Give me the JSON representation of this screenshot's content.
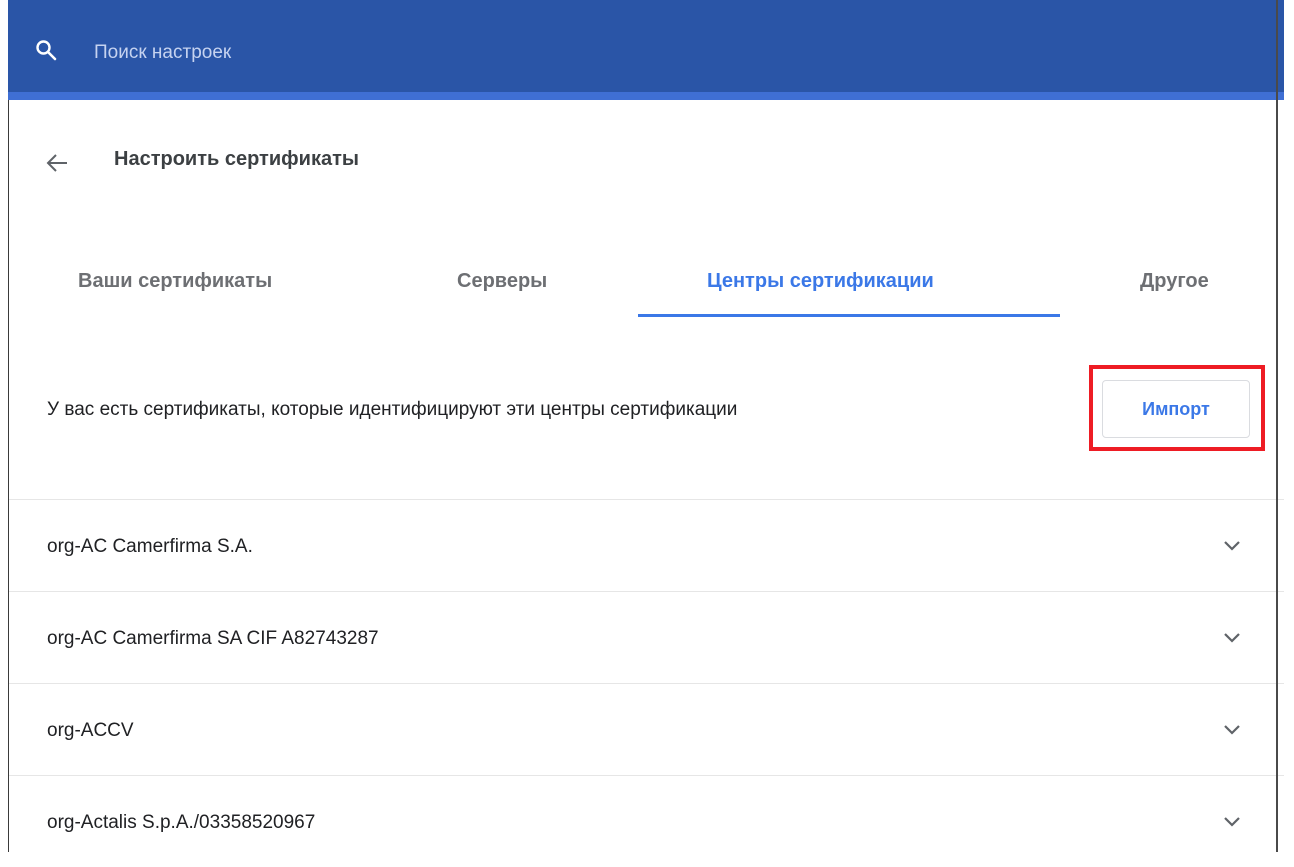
{
  "search": {
    "placeholder": "Поиск настроек"
  },
  "header": {
    "title": "Настроить сертификаты"
  },
  "tabs": [
    {
      "label": "Ваши сертификаты"
    },
    {
      "label": "Серверы"
    },
    {
      "label": "Центры сертификации",
      "active": true
    },
    {
      "label": "Другое"
    }
  ],
  "main": {
    "description": "У вас есть сертификаты, которые идентифицируют эти центры сертификации",
    "import_label": "Импорт"
  },
  "certificates": [
    {
      "name": "org-AC Camerfirma S.A."
    },
    {
      "name": "org-AC Camerfirma SA CIF A82743287"
    },
    {
      "name": "org-ACCV"
    },
    {
      "name": "org-Actalis S.p.A./03358520967"
    }
  ],
  "colors": {
    "header_bg": "#2a55a7",
    "accent": "#3b78e7",
    "highlight": "#ee1c24"
  }
}
